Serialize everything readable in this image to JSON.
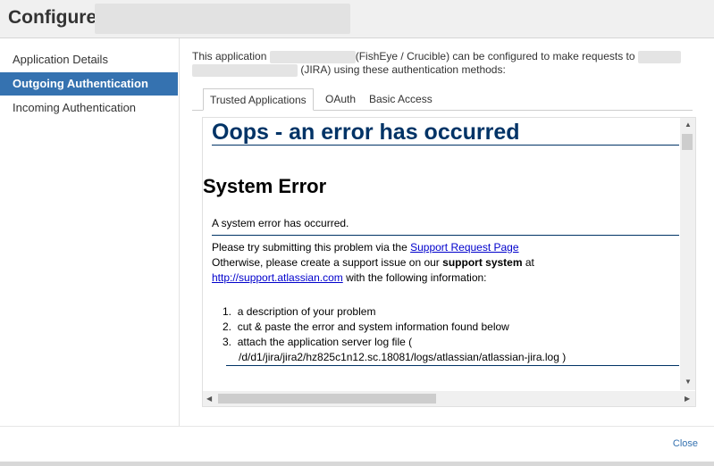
{
  "header": {
    "title": "Configure"
  },
  "sidebar": {
    "items": [
      {
        "label": "Application Details"
      },
      {
        "label": "Outgoing Authentication"
      },
      {
        "label": "Incoming Authentication"
      }
    ]
  },
  "intro": {
    "part1": "This application",
    "part2": "(FishEye / Crucible) can be configured to make requests to",
    "part3": "(JIRA) using these authentication methods:"
  },
  "tabs": [
    {
      "label": "Trusted Applications"
    },
    {
      "label": "OAuth"
    },
    {
      "label": "Basic Access"
    }
  ],
  "error": {
    "heading": "Oops - an error has occurred",
    "subheading": "System Error",
    "message": "A system error has occurred.",
    "line1": "Please try submitting this problem via the",
    "support_link": "Support Request Page",
    "line2a": "Otherwise, please create a support issue on our",
    "support_system": "support system",
    "line2b": "at",
    "support_url": "http://support.atlassian.com",
    "line3": "with the following information:",
    "list": [
      "a description of your problem",
      "cut & paste the error and system information found below",
      "attach the application server log file ("
    ],
    "log_path": "/d/d1/jira/jira2/hz825c1n12.sc.18081/logs/atlassian/atlassian-jira.log )"
  },
  "footer": {
    "close_label": "Close"
  }
}
